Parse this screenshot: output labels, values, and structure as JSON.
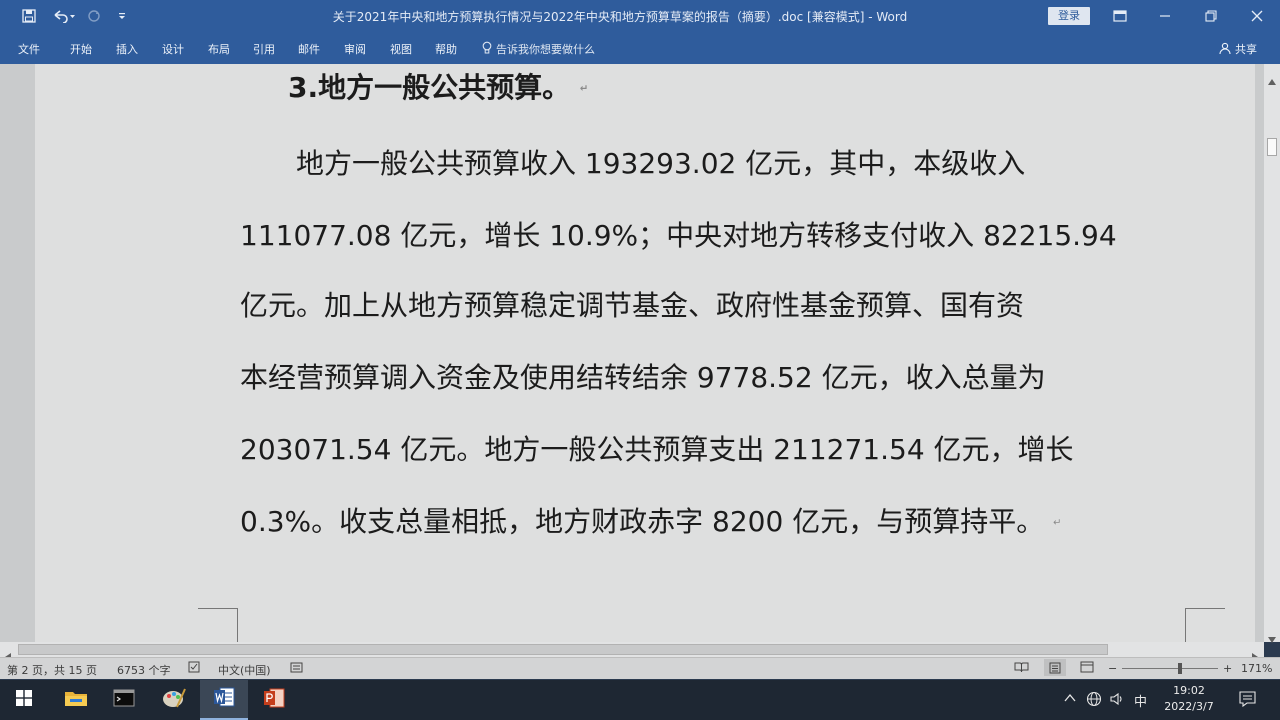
{
  "titlebar": {
    "title": "关于2021年中央和地方预算执行情况与2022年中央和地方预算草案的报告（摘要）.doc [兼容模式] - Word",
    "login_label": "登录"
  },
  "ribbon": {
    "tabs": [
      "文件",
      "开始",
      "插入",
      "设计",
      "布局",
      "引用",
      "邮件",
      "审阅",
      "视图",
      "帮助"
    ],
    "tell_me": "告诉我你想要做什么",
    "share": "共享"
  },
  "document": {
    "heading": "3.地方一般公共预算。",
    "lines": [
      "　　地方一般公共预算收入 193293.02 亿元，其中，本级收入",
      "111077.08 亿元，增长 10.9%；中央对地方转移支付收入 82215.94",
      "亿元。加上从地方预算稳定调节基金、政府性基金预算、国有资",
      "本经营预算调入资金及使用结转结余 9778.52 亿元，收入总量为",
      "203071.54 亿元。地方一般公共预算支出 211271.54 亿元，增长",
      "0.3%。收支总量相抵，地方财政赤字 8200 亿元，与预算持平。"
    ],
    "paragraph_mark": "↵"
  },
  "statusbar": {
    "page": "第 2 页，共 15 页",
    "words": "6753 个字",
    "language": "中文(中国)",
    "zoom": "171%",
    "zoom_minus": "−",
    "zoom_plus": "+"
  },
  "taskbar": {
    "ime": "中",
    "time": "19:02",
    "date": "2022/3/7"
  },
  "colors": {
    "word_blue": "#2f5c9c",
    "page_bg": "#dedfdf",
    "taskbar": "#1e2733"
  }
}
